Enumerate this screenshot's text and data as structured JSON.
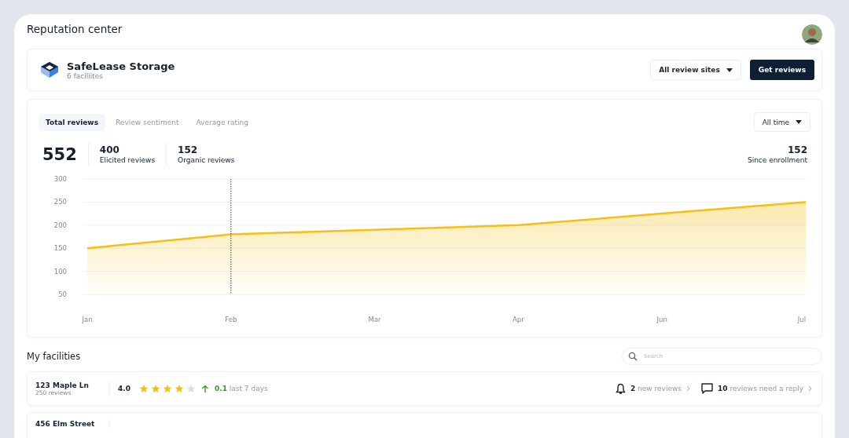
{
  "page": {
    "title": "Reputation center"
  },
  "company": {
    "name": "SafeLease Storage",
    "subtitle": "6 faciliites"
  },
  "actions": {
    "filter": "All review sites",
    "primary": "Get reviews"
  },
  "tabs": [
    {
      "label": "Total reviews",
      "selected": true
    },
    {
      "label": "Review sentiment",
      "selected": false
    },
    {
      "label": "Average rating",
      "selected": false
    }
  ],
  "range": "All time",
  "stats": {
    "total": "552",
    "items": [
      {
        "value": "400",
        "label": "Elicited reviews"
      },
      {
        "value": "152",
        "label": "Organic reviews"
      }
    ],
    "side": {
      "value": "152",
      "label": "Since enrollment"
    }
  },
  "chart_data": {
    "type": "area",
    "categories": [
      "Jan",
      "Feb",
      "Mar",
      "Apr",
      "Jun",
      "Jul"
    ],
    "series": [
      {
        "color": "#f5bf17",
        "values": [
          150,
          180,
          190,
          200,
          225,
          250
        ]
      }
    ],
    "ylim": [
      50,
      300
    ],
    "yticks": [
      50,
      100,
      150,
      200,
      250,
      300
    ],
    "grid": true,
    "ref_lines": [
      {
        "axis": "x",
        "value": "Feb"
      }
    ]
  },
  "facilities": {
    "title": "My facilities",
    "search": {
      "placeholder": "Search"
    },
    "rows": [
      {
        "name": "123 Maple Ln",
        "count": "250 reviews",
        "rating": "4.0",
        "stars": 4,
        "kind": "up",
        "change": "0.1",
        "period": "last 7 days",
        "new_count": "2",
        "new_label": "new reviews",
        "reply_count": "10",
        "reply_label": "reviews need a reply"
      },
      {
        "name": "456 Elm Street"
      }
    ]
  }
}
